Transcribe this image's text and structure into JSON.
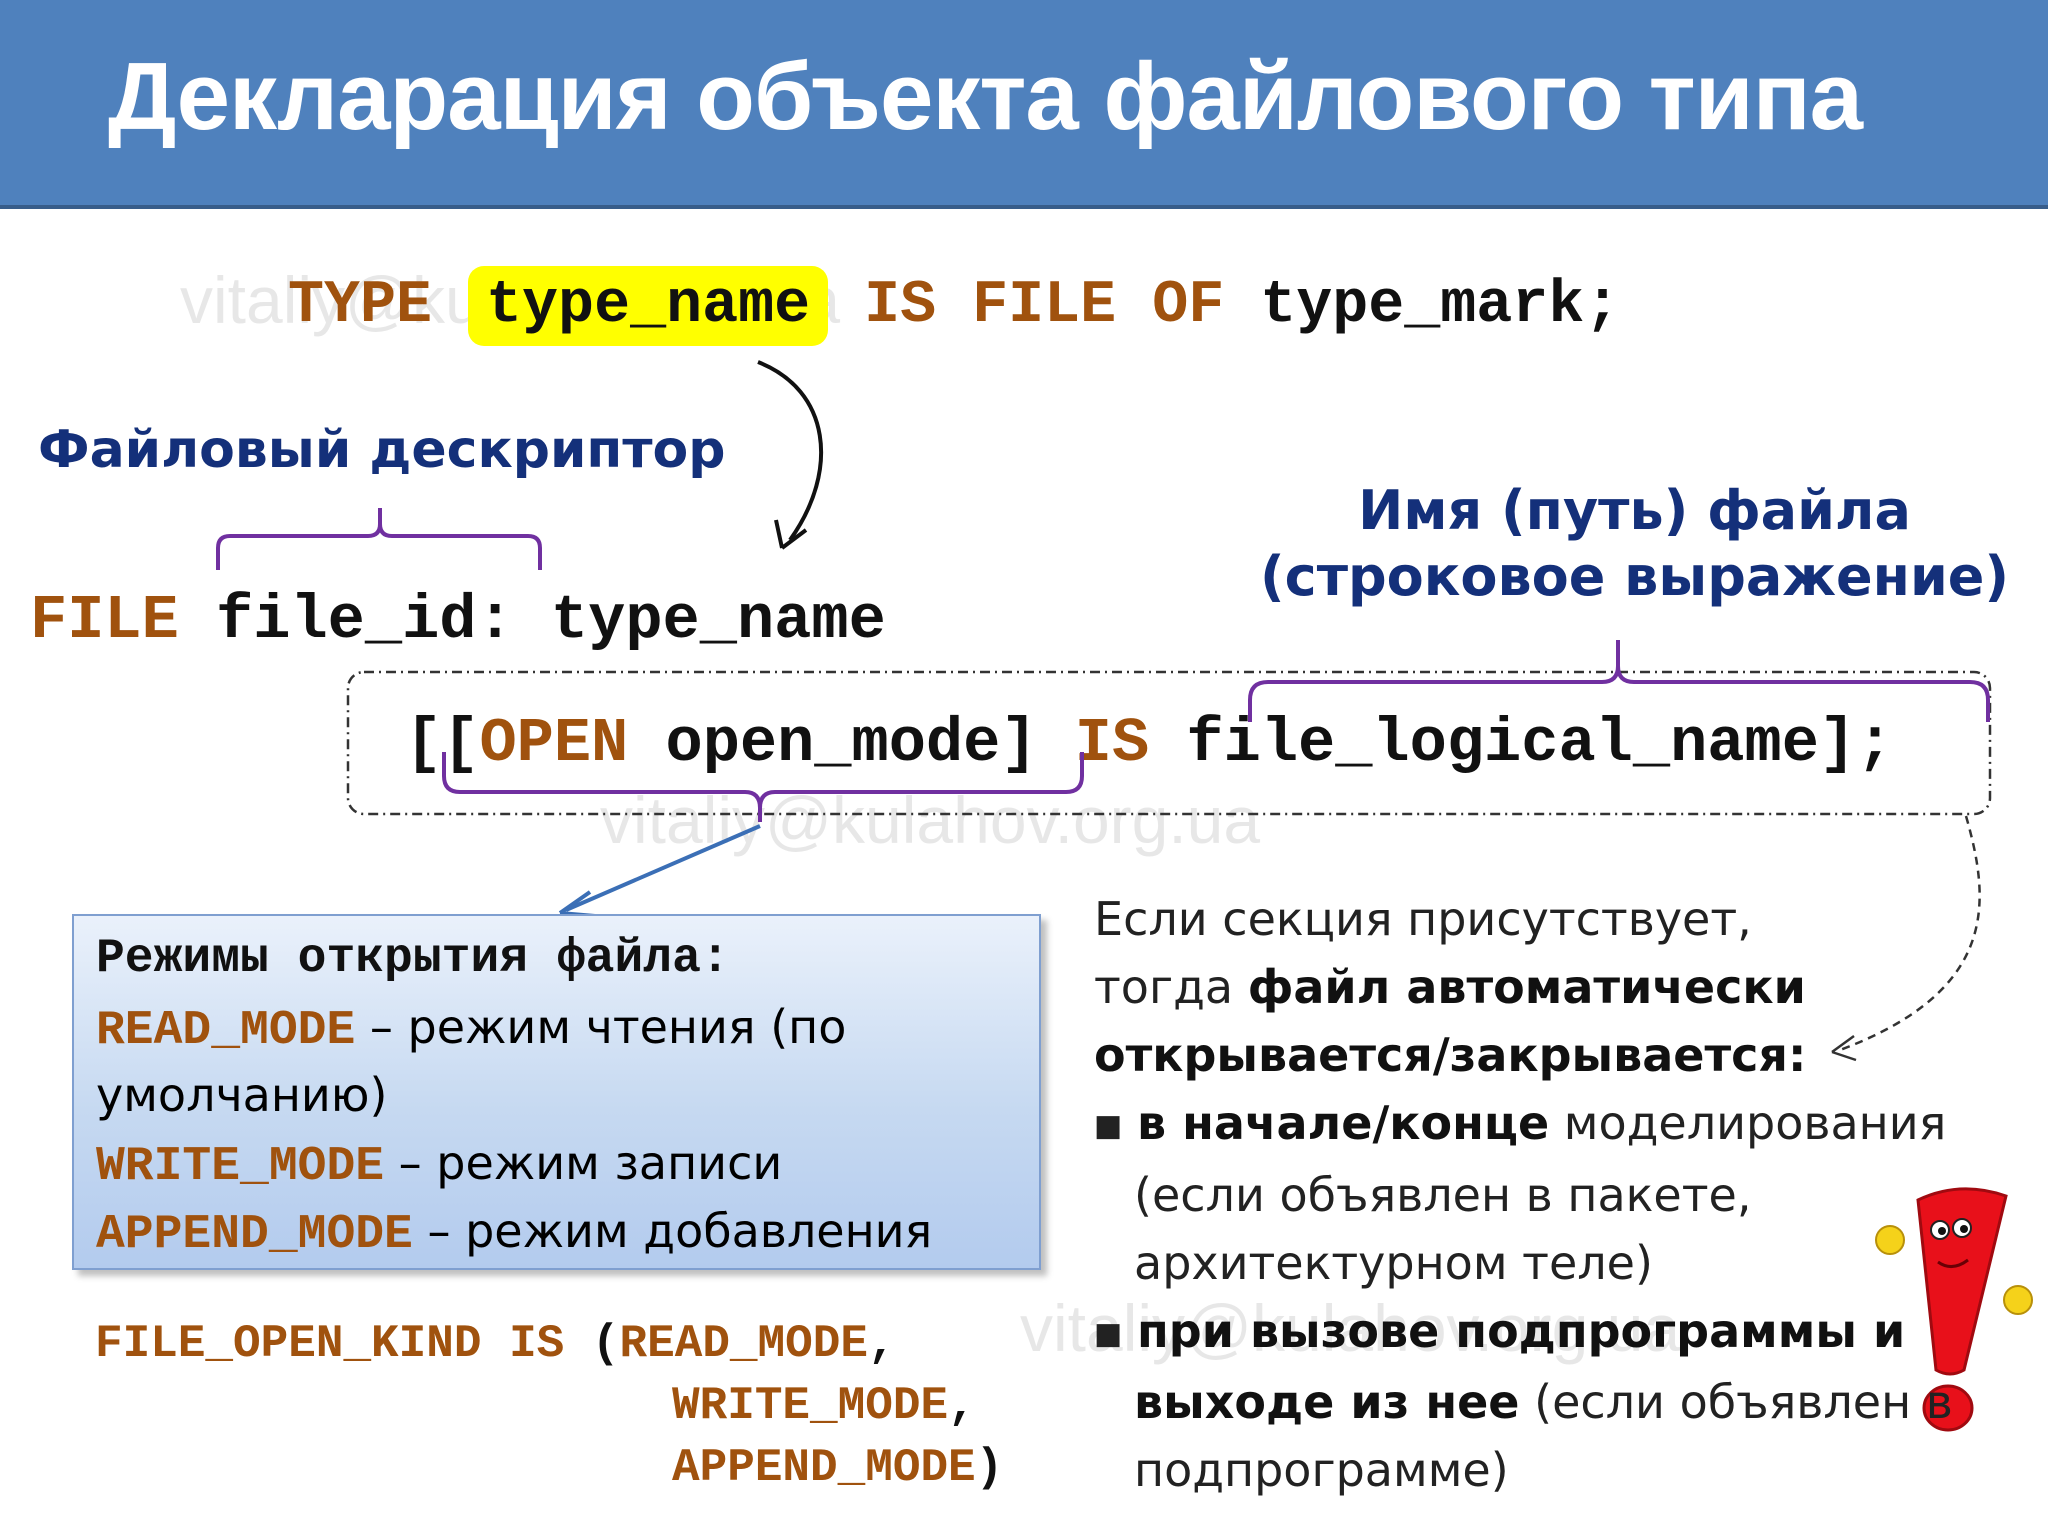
{
  "title": "Декларация объекта файлового типа",
  "type_decl": {
    "kw_type": "TYPE",
    "type_name": "type_name",
    "kw_is": "IS",
    "kw_file": "FILE",
    "kw_of": "OF",
    "type_mark": "type_mark",
    "semi": ";"
  },
  "labels": {
    "file_descriptor": "Файловый дескриптор",
    "file_name_line1": "Имя (путь) файла",
    "file_name_line2": "(строковое выражение)"
  },
  "file_decl": {
    "kw_file": "FILE",
    "file_id": "file_id:",
    "type_name": "type_name",
    "open_bracket": "[",
    "open_bracket2": "[",
    "kw_open": "OPEN",
    "open_mode": "open_mode]",
    "kw_is": "IS",
    "logical_name": "file_logical_name]",
    "semi": ";"
  },
  "modes_box": {
    "title": "Режимы открытия файла:",
    "read_kw": "READ_MODE",
    "read_desc_1": " – режим чтения (по",
    "read_desc_2": "умолчанию)",
    "write_kw": "WRITE_MODE",
    "write_desc": " – режим записи",
    "append_kw": "APPEND_MODE",
    "append_desc": "  – режим добавления"
  },
  "open_kind": {
    "kw_type": "FILE_OPEN_KIND",
    "kw_is": "IS",
    "paren_open": "(",
    "v1": "READ_MODE",
    "comma1": ",",
    "v2": "WRITE_MODE",
    "comma2": ",",
    "v3": "APPEND_MODE",
    "paren_close": ")"
  },
  "auto_note": {
    "line1": "Если секция присутствует,",
    "line2_plain": "тогда ",
    "line2_bold": "файл автоматически",
    "line3_bold": "открывается/закрывается:",
    "bullet1_bold": "в начале/конце",
    "bullet1_rest": " моделирования",
    "bullet1_line2": "(если объявлен в пакете,",
    "bullet1_line3": "архитектурном теле)",
    "bullet2_bold_1": "при вызове подпрограммы  и",
    "bullet2_bold_2": "выходе из нее",
    "bullet2_rest": " (если объявлен в",
    "bullet2_line3": "подпрограмме)"
  },
  "watermark": "vitaliy@kulahov.org.ua",
  "colors": {
    "title_bg": "#4f81bd",
    "keyword": "#a0520e",
    "label": "#14307a",
    "highlight": "#ffff00",
    "brace": "#7030a0"
  }
}
